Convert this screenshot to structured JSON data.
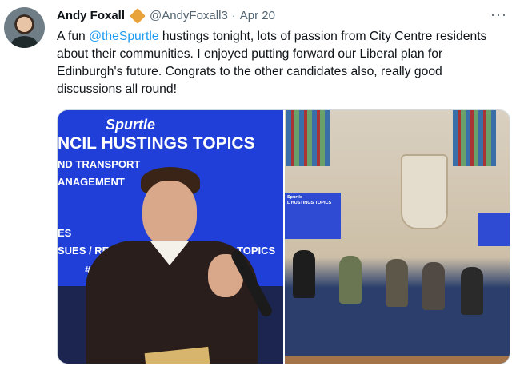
{
  "tweet": {
    "author_name": "Andy Foxall",
    "author_handle": "@AndyFoxall3",
    "separator": "·",
    "date": "Apr 20",
    "more_label": "···",
    "text_prefix": "A fun ",
    "mention": "@theSpurtle",
    "text_suffix": " hustings tonight, lots of passion from City Centre residents about their communities. I enjoyed putting forward our Liberal plan for Edinburgh's future. Congrats to the other candidates also, really good discussions all round!"
  },
  "media": {
    "left_screen": {
      "title": "Spurtle",
      "heading": "NCIL HUSTINGS TOPICS",
      "line1": "ND TRANSPORT",
      "line2": "ANAGEMENT",
      "line3": "ES",
      "line4": "SUES / RE",
      "line5": "VIOUS TOPICS",
      "line6": "#"
    },
    "right_screen": {
      "title": "Spurtle",
      "heading": "L HUSTINGS TOPICS"
    }
  },
  "colors": {
    "accent": "#1d9bf0",
    "badge": "#e8a33a",
    "secondary_text": "#536471"
  }
}
